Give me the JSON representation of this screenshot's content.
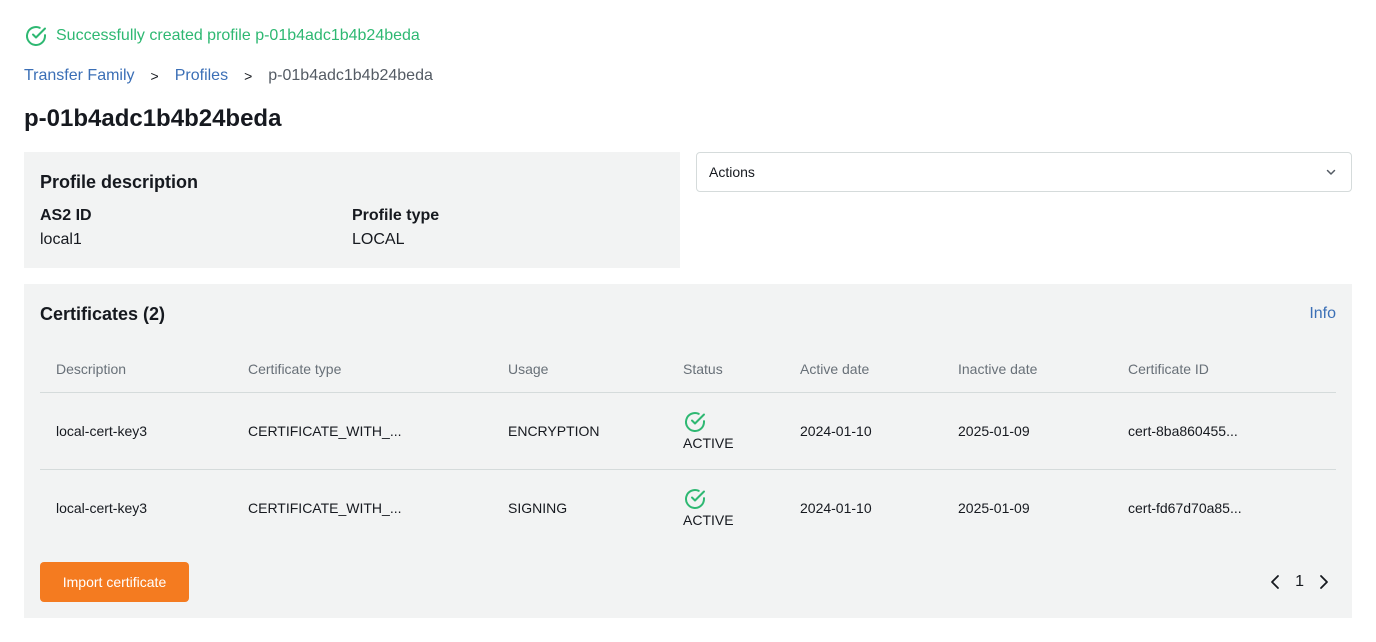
{
  "flash": {
    "message": "Successfully created profile p-01b4adc1b4b24beda",
    "color": "#2eb872",
    "icon": "check-circle-icon"
  },
  "breadcrumb": {
    "items": [
      "Transfer Family",
      "Profiles"
    ],
    "separator": ">",
    "current": "p-01b4adc1b4b24beda"
  },
  "page_title": "p-01b4adc1b4b24beda",
  "profile": {
    "heading": "Profile description",
    "fields": [
      {
        "label": "AS2 ID",
        "value": "local1"
      },
      {
        "label": "Profile type",
        "value": "LOCAL"
      }
    ]
  },
  "actions": {
    "label": "Actions",
    "icon": "chevron-down-icon"
  },
  "certificates": {
    "heading": "Certificates (2)",
    "info_link": "Info",
    "columns": [
      "Description",
      "Certificate type",
      "Usage",
      "Status",
      "Active date",
      "Inactive date",
      "Certificate ID"
    ],
    "rows": [
      [
        "local-cert-key3",
        "CERTIFICATE_WITH_...",
        "ENCRYPTION",
        "ACTIVE",
        "2024-01-10",
        "2025-01-09",
        "cert-8ba860455..."
      ],
      [
        "local-cert-key3",
        "CERTIFICATE_WITH_...",
        "SIGNING",
        "ACTIVE",
        "2024-01-10",
        "2025-01-09",
        "cert-fd67d70a85..."
      ]
    ],
    "import_button": "Import certificate",
    "page": "1"
  },
  "colors": {
    "accent": "#f47b20",
    "link": "#3b6fb6",
    "success": "#2eb872",
    "panel": "#f2f3f3"
  }
}
